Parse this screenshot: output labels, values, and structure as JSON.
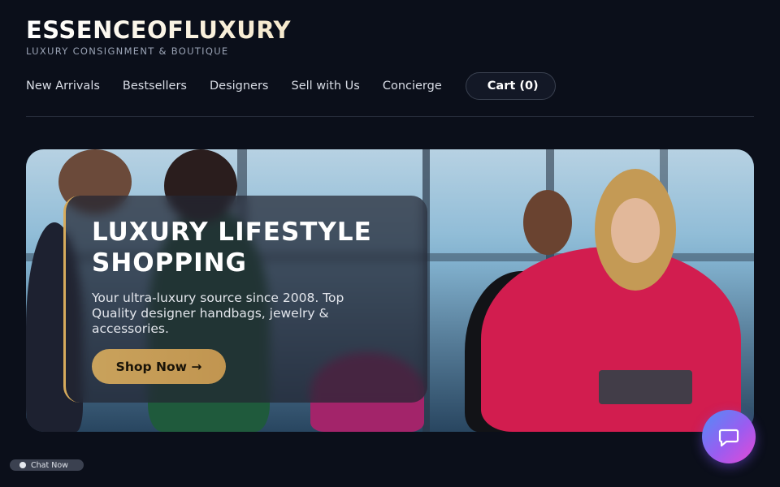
{
  "brand": {
    "logo_text": "ESSENCEOFLUXURY",
    "tagline": "LUXURY CONSIGNMENT & BOUTIQUE"
  },
  "nav": {
    "items": [
      {
        "label": "New Arrivals"
      },
      {
        "label": "Bestsellers"
      },
      {
        "label": "Designers"
      },
      {
        "label": "Sell with Us"
      },
      {
        "label": "Concierge"
      }
    ],
    "cart": {
      "icon": "",
      "label": "Cart (0)"
    }
  },
  "hero": {
    "title": "LUXURY LIFESTYLE SHOPPING",
    "subtitle": "Your ultra-luxury source since 2008. Top Quality designer handbags, jewelry & accessories.",
    "cta_label": "Shop Now →"
  },
  "chat_widget": {
    "label": "Chat Now",
    "fab_icon": "chat-bubble-icon"
  },
  "colors": {
    "accent_gold": "#d6ab5c",
    "background": "#0b0f1a"
  }
}
